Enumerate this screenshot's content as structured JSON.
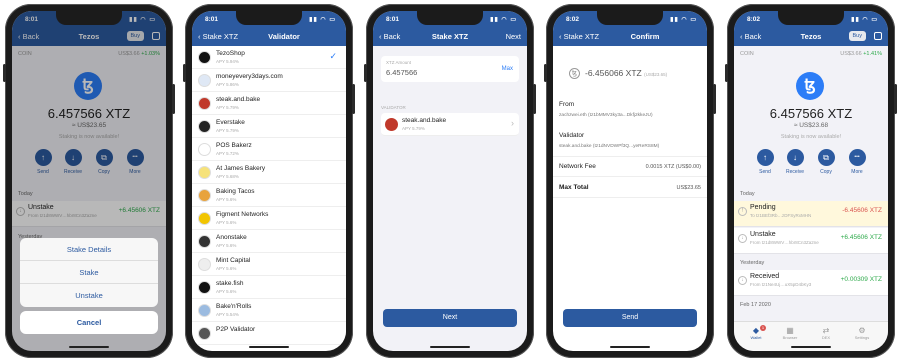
{
  "status": {
    "time1": "8:01",
    "time2": "8:01",
    "time3": "8:01",
    "time4": "8:02",
    "time5": "8:02"
  },
  "phone1": {
    "back": "Back",
    "title": "Tezos",
    "buy": "Buy",
    "coin_label": "COIN",
    "coin_price": "US$3.66",
    "coin_change": "+1.03%",
    "amount": "6.457566 XTZ",
    "usd": "≈ US$23.65",
    "note": "Staking is now available!",
    "actions": [
      {
        "label": "Send",
        "icon": "↑"
      },
      {
        "label": "Receive",
        "icon": "↓"
      },
      {
        "label": "Copy",
        "icon": "⧉"
      },
      {
        "label": "More",
        "icon": "•••"
      }
    ],
    "today": "Today",
    "tx": {
      "name": "Unstake",
      "addr": "From tz1d8WWV…hbr8Cn3Za2ne",
      "value": "+6.45606 XTZ"
    },
    "yesterday": "Yesterday",
    "sheet": [
      "Stake Details",
      "Stake",
      "Unstake"
    ],
    "cancel": "Cancel"
  },
  "phone2": {
    "back": "Stake XTZ",
    "title": "Validator",
    "validators": [
      {
        "name": "TezoShop",
        "apy": "APY 5.94%",
        "color": "#111111"
      },
      {
        "name": "moneyevery3days.com",
        "apy": "APY 5.86%",
        "color": "#dfe8f5"
      },
      {
        "name": "steak.and.bake",
        "apy": "APY 5.79%",
        "color": "#c0392b"
      },
      {
        "name": "Everstake",
        "apy": "APY 5.79%",
        "color": "#222222"
      },
      {
        "name": "POS Bakerz",
        "apy": "APY 5.72%",
        "color": "#ffffff"
      },
      {
        "name": "At James Bakery",
        "apy": "APY 5.68%",
        "color": "#f6e27a"
      },
      {
        "name": "Baking Tacos",
        "apy": "APY 5.6%",
        "color": "#e8a33d"
      },
      {
        "name": "Figment Networks",
        "apy": "APY 5.6%",
        "color": "#f2c500"
      },
      {
        "name": "Anonstake",
        "apy": "APY 5.6%",
        "color": "#333333"
      },
      {
        "name": "Mint Capital",
        "apy": "APY 5.6%",
        "color": "#eeeeee"
      },
      {
        "name": "stake.fish",
        "apy": "APY 5.6%",
        "color": "#111111"
      },
      {
        "name": "Bake'n'Rolls",
        "apy": "APY 5.54%",
        "color": "#9bbbe0"
      },
      {
        "name": "P2P Validator",
        "apy": "",
        "color": "#555555"
      }
    ]
  },
  "phone3": {
    "back": "Back",
    "title": "Stake XTZ",
    "next": "Next",
    "amount_label": "XTZ Amount",
    "amount": "6.457566",
    "max": "Max",
    "validator_label": "VALIDATOR",
    "validator_name": "steak.and.bake",
    "validator_apy": "APY 5.79%",
    "button": "Next"
  },
  "phone4": {
    "back": "Stake XTZ",
    "title": "Confirm",
    "amount": "-6.456066 XTZ",
    "amount_usd": "(US$23.65)",
    "from_label": "From",
    "from_value": "zachzwei.eth (tz1bMMV3ky3a...Dkfj2kkeJU)",
    "validator_label": "Validator",
    "validator_value": "steak.and.bake (tz1dNVDWPf3Q...yeReRS8M)",
    "fee_label": "Network Fee",
    "fee_value": "0.0015 XTZ (US$0.00)",
    "total_label": "Max Total",
    "total_value": "US$23.65",
    "button": "Send"
  },
  "phone5": {
    "back": "Back",
    "title": "Tezos",
    "buy": "Buy",
    "coin_label": "COIN",
    "coin_price": "US$3.66",
    "coin_change": "+1.41%",
    "amount": "6.457566 XTZ",
    "usd": "≈ US$23.68",
    "note": "Staking is now available!",
    "actions": [
      {
        "label": "Send",
        "icon": "↑"
      },
      {
        "label": "Receive",
        "icon": "↓"
      },
      {
        "label": "Copy",
        "icon": "⧉"
      },
      {
        "label": "More",
        "icon": "•••"
      }
    ],
    "today": "Today",
    "txs": [
      {
        "name": "Pending",
        "addr": "To tz1BEf3Rb…zDFSyRxMHN",
        "value": "-6.45606 XTZ",
        "kind": "red"
      },
      {
        "name": "Unstake",
        "addr": "From tz1d8WWV…hbr8Cn3Za2ne",
        "value": "+6.45606 XTZ",
        "kind": "green"
      }
    ],
    "yesterday": "Yesterday",
    "tx3": {
      "name": "Received",
      "addr": "From tz1Ne4Uj…uX5pD4bKy3",
      "value": "+0.00309 XTZ"
    },
    "feb": "Feb 17 2020",
    "tabs": [
      {
        "label": "Wallet",
        "icon": "◆"
      },
      {
        "label": "Browser",
        "icon": "▦"
      },
      {
        "label": "DEX",
        "icon": "⇄"
      },
      {
        "label": "Settings",
        "icon": "⚙"
      }
    ],
    "badge": "1"
  }
}
